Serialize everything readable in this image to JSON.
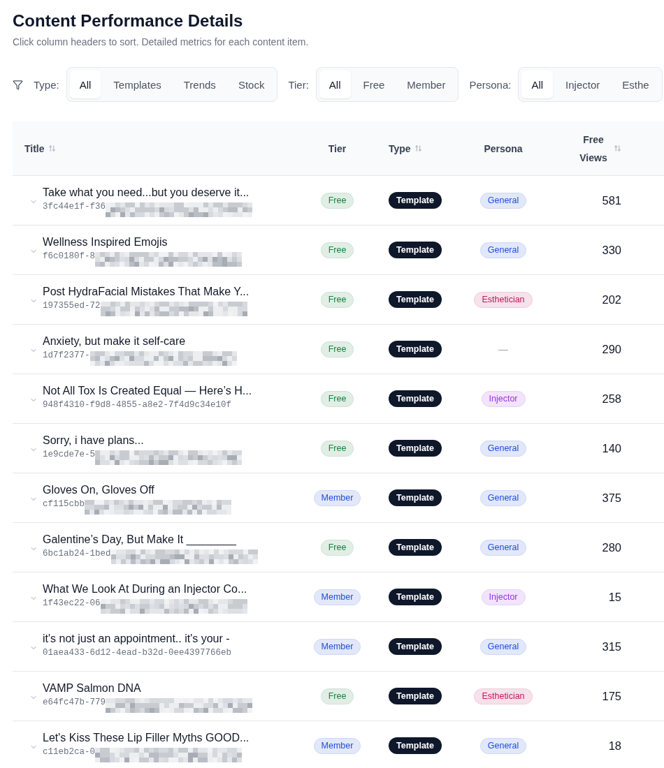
{
  "page": {
    "title": "Content Performance Details",
    "subtitle": "Click column headers to sort. Detailed metrics for each content item."
  },
  "filters": [
    {
      "label": "Type:",
      "options": [
        {
          "label": "All",
          "selected": true
        },
        {
          "label": "Templates",
          "selected": false
        },
        {
          "label": "Trends",
          "selected": false
        },
        {
          "label": "Stock",
          "selected": false
        }
      ]
    },
    {
      "label": "Tier:",
      "options": [
        {
          "label": "All",
          "selected": true
        },
        {
          "label": "Free",
          "selected": false
        },
        {
          "label": "Member",
          "selected": false
        }
      ]
    },
    {
      "label": "Persona:",
      "options": [
        {
          "label": "All",
          "selected": true
        },
        {
          "label": "Injector",
          "selected": false
        },
        {
          "label": "Esthe",
          "selected": false
        }
      ]
    }
  ],
  "table": {
    "columns": [
      {
        "label": "Title",
        "sortable": true
      },
      {
        "label": "Tier",
        "sortable": false
      },
      {
        "label": "Type",
        "sortable": true
      },
      {
        "label": "Persona",
        "sortable": false
      },
      {
        "label": "Free Views",
        "sortable": true
      }
    ],
    "rows": [
      {
        "expanded": false,
        "title": "Take what you need...but you deserve it...",
        "id": "3fc44e1f-f36",
        "id_redacted": true,
        "tier": {
          "label": "Free",
          "color": "#15803d"
        },
        "type": "Template",
        "persona": {
          "label": "General",
          "color": "#1d4ed8"
        },
        "free_views": "581"
      },
      {
        "expanded": false,
        "title": "Wellness Inspired Emojis",
        "id": "f6c0180f-8",
        "id_redacted": true,
        "tier": {
          "label": "Free",
          "color": "#15803d"
        },
        "type": "Template",
        "persona": {
          "label": "General",
          "color": "#1d4ed8"
        },
        "free_views": "330"
      },
      {
        "expanded": false,
        "title": "Post HydraFacial Mistakes That Make Y...",
        "id": "197355ed-72",
        "id_redacted": true,
        "tier": {
          "label": "Free",
          "color": "#15803d"
        },
        "type": "Template",
        "persona": {
          "label": "Esthetician",
          "color": "#be185d"
        },
        "free_views": "202"
      },
      {
        "expanded": false,
        "title": "Anxiety, but make it self-care",
        "id": "1d7f2377-",
        "id_redacted": true,
        "tier": {
          "label": "Free",
          "color": "#15803d"
        },
        "type": "Template",
        "persona": {
          "label": "—"
        },
        "free_views": "290"
      },
      {
        "expanded": false,
        "title": "Not All Tox Is Created Equal — Here’s H...",
        "id": "948f4310-f9d8-4855-a8e2-7f4d9c34e10f",
        "id_redacted": false,
        "tier": {
          "label": "Free",
          "color": "#15803d"
        },
        "type": "Template",
        "persona": {
          "label": "Injector",
          "color": "#9333ea"
        },
        "free_views": "258"
      },
      {
        "expanded": false,
        "title": "Sorry, i have plans...",
        "id": "1e9cde7e-5",
        "id_redacted": true,
        "tier": {
          "label": "Free",
          "color": "#15803d"
        },
        "type": "Template",
        "persona": {
          "label": "General",
          "color": "#1d4ed8"
        },
        "free_views": "140"
      },
      {
        "expanded": false,
        "title": "Gloves On, Gloves Off",
        "id": "cf115cbb",
        "id_redacted": true,
        "tier": {
          "label": "Member",
          "color": "#1d4ed8"
        },
        "type": "Template",
        "persona": {
          "label": "General",
          "color": "#1d4ed8"
        },
        "free_views": "375"
      },
      {
        "expanded": false,
        "title": "Galentine’s Day, But Make It ________",
        "id": "6bc1ab24-1bed",
        "id_redacted": true,
        "tier": {
          "label": "Free",
          "color": "#15803d"
        },
        "type": "Template",
        "persona": {
          "label": "General",
          "color": "#1d4ed8"
        },
        "free_views": "280"
      },
      {
        "expanded": false,
        "title": "What We Look At During an Injector Co...",
        "id": "1f43ec22-06",
        "id_redacted": true,
        "tier": {
          "label": "Member",
          "color": "#1d4ed8"
        },
        "type": "Template",
        "persona": {
          "label": "Injector",
          "color": "#9333ea"
        },
        "free_views": "15"
      },
      {
        "expanded": false,
        "title": "it's not just an appointment.. it's your -",
        "id": "01aea433-6d12-4ead-b32d-0ee4397766eb",
        "id_redacted": false,
        "tier": {
          "label": "Member",
          "color": "#1d4ed8"
        },
        "type": "Template",
        "persona": {
          "label": "General",
          "color": "#1d4ed8"
        },
        "free_views": "315"
      },
      {
        "expanded": false,
        "title": "VAMP Salmon DNA",
        "id": "e64fc47b-779",
        "id_redacted": true,
        "tier": {
          "label": "Free",
          "color": "#15803d"
        },
        "type": "Template",
        "persona": {
          "label": "Esthetician",
          "color": "#be185d"
        },
        "free_views": "175"
      },
      {
        "expanded": false,
        "title": "Let's Kiss These Lip Filler Myths GOOD...",
        "id": "c11eb2ca-0",
        "id_redacted": true,
        "tier": {
          "label": "Member",
          "color": "#1d4ed8"
        },
        "type": "Template",
        "persona": {
          "label": "General",
          "color": "#1d4ed8"
        },
        "free_views": "18"
      }
    ]
  }
}
